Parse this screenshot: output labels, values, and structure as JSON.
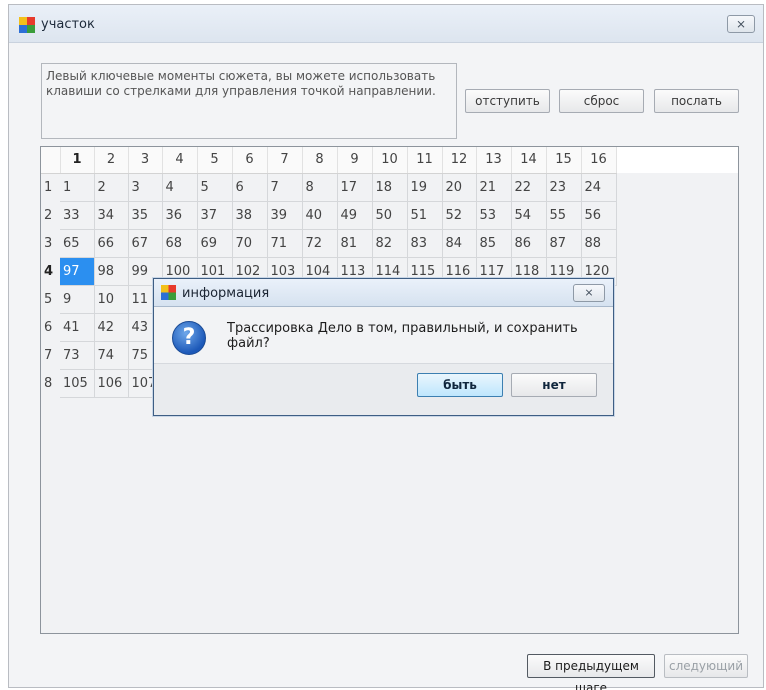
{
  "window": {
    "title": "участок",
    "close_label": "⨯"
  },
  "info_text": "Левый ключевые моменты сюжета, вы можете использовать клавиши со стрелками для управления точкой направлении.",
  "buttons": {
    "back": "отступить",
    "reset": "сброс",
    "send": "послать",
    "prev": "В предыдущем шаге",
    "next": "следующий"
  },
  "grid": {
    "columns": [
      "1",
      "2",
      "3",
      "4",
      "5",
      "6",
      "7",
      "8",
      "9",
      "10",
      "11",
      "12",
      "13",
      "14",
      "15",
      "16"
    ],
    "rows": [
      {
        "label": "1",
        "cells": [
          "1",
          "2",
          "3",
          "4",
          "5",
          "6",
          "7",
          "8",
          "17",
          "18",
          "19",
          "20",
          "21",
          "22",
          "23",
          "24"
        ]
      },
      {
        "label": "2",
        "cells": [
          "33",
          "34",
          "35",
          "36",
          "37",
          "38",
          "39",
          "40",
          "49",
          "50",
          "51",
          "52",
          "53",
          "54",
          "55",
          "56"
        ]
      },
      {
        "label": "3",
        "cells": [
          "65",
          "66",
          "67",
          "68",
          "69",
          "70",
          "71",
          "72",
          "81",
          "82",
          "83",
          "84",
          "85",
          "86",
          "87",
          "88"
        ]
      },
      {
        "label": "4",
        "cells": [
          "97",
          "98",
          "99",
          "100",
          "101",
          "102",
          "103",
          "104",
          "113",
          "114",
          "115",
          "116",
          "117",
          "118",
          "119",
          "120"
        ]
      },
      {
        "label": "5",
        "cells": [
          "9",
          "10",
          "11"
        ]
      },
      {
        "label": "6",
        "cells": [
          "41",
          "42",
          "43"
        ]
      },
      {
        "label": "7",
        "cells": [
          "73",
          "74",
          "75"
        ]
      },
      {
        "label": "8",
        "cells": [
          "105",
          "106",
          "107"
        ]
      }
    ]
  },
  "dialog": {
    "title": "информация",
    "close_label": "⨯",
    "message": "Трассировка Дело в том, правильный, и сохранить файл?",
    "yes": "быть",
    "no": "нет"
  }
}
